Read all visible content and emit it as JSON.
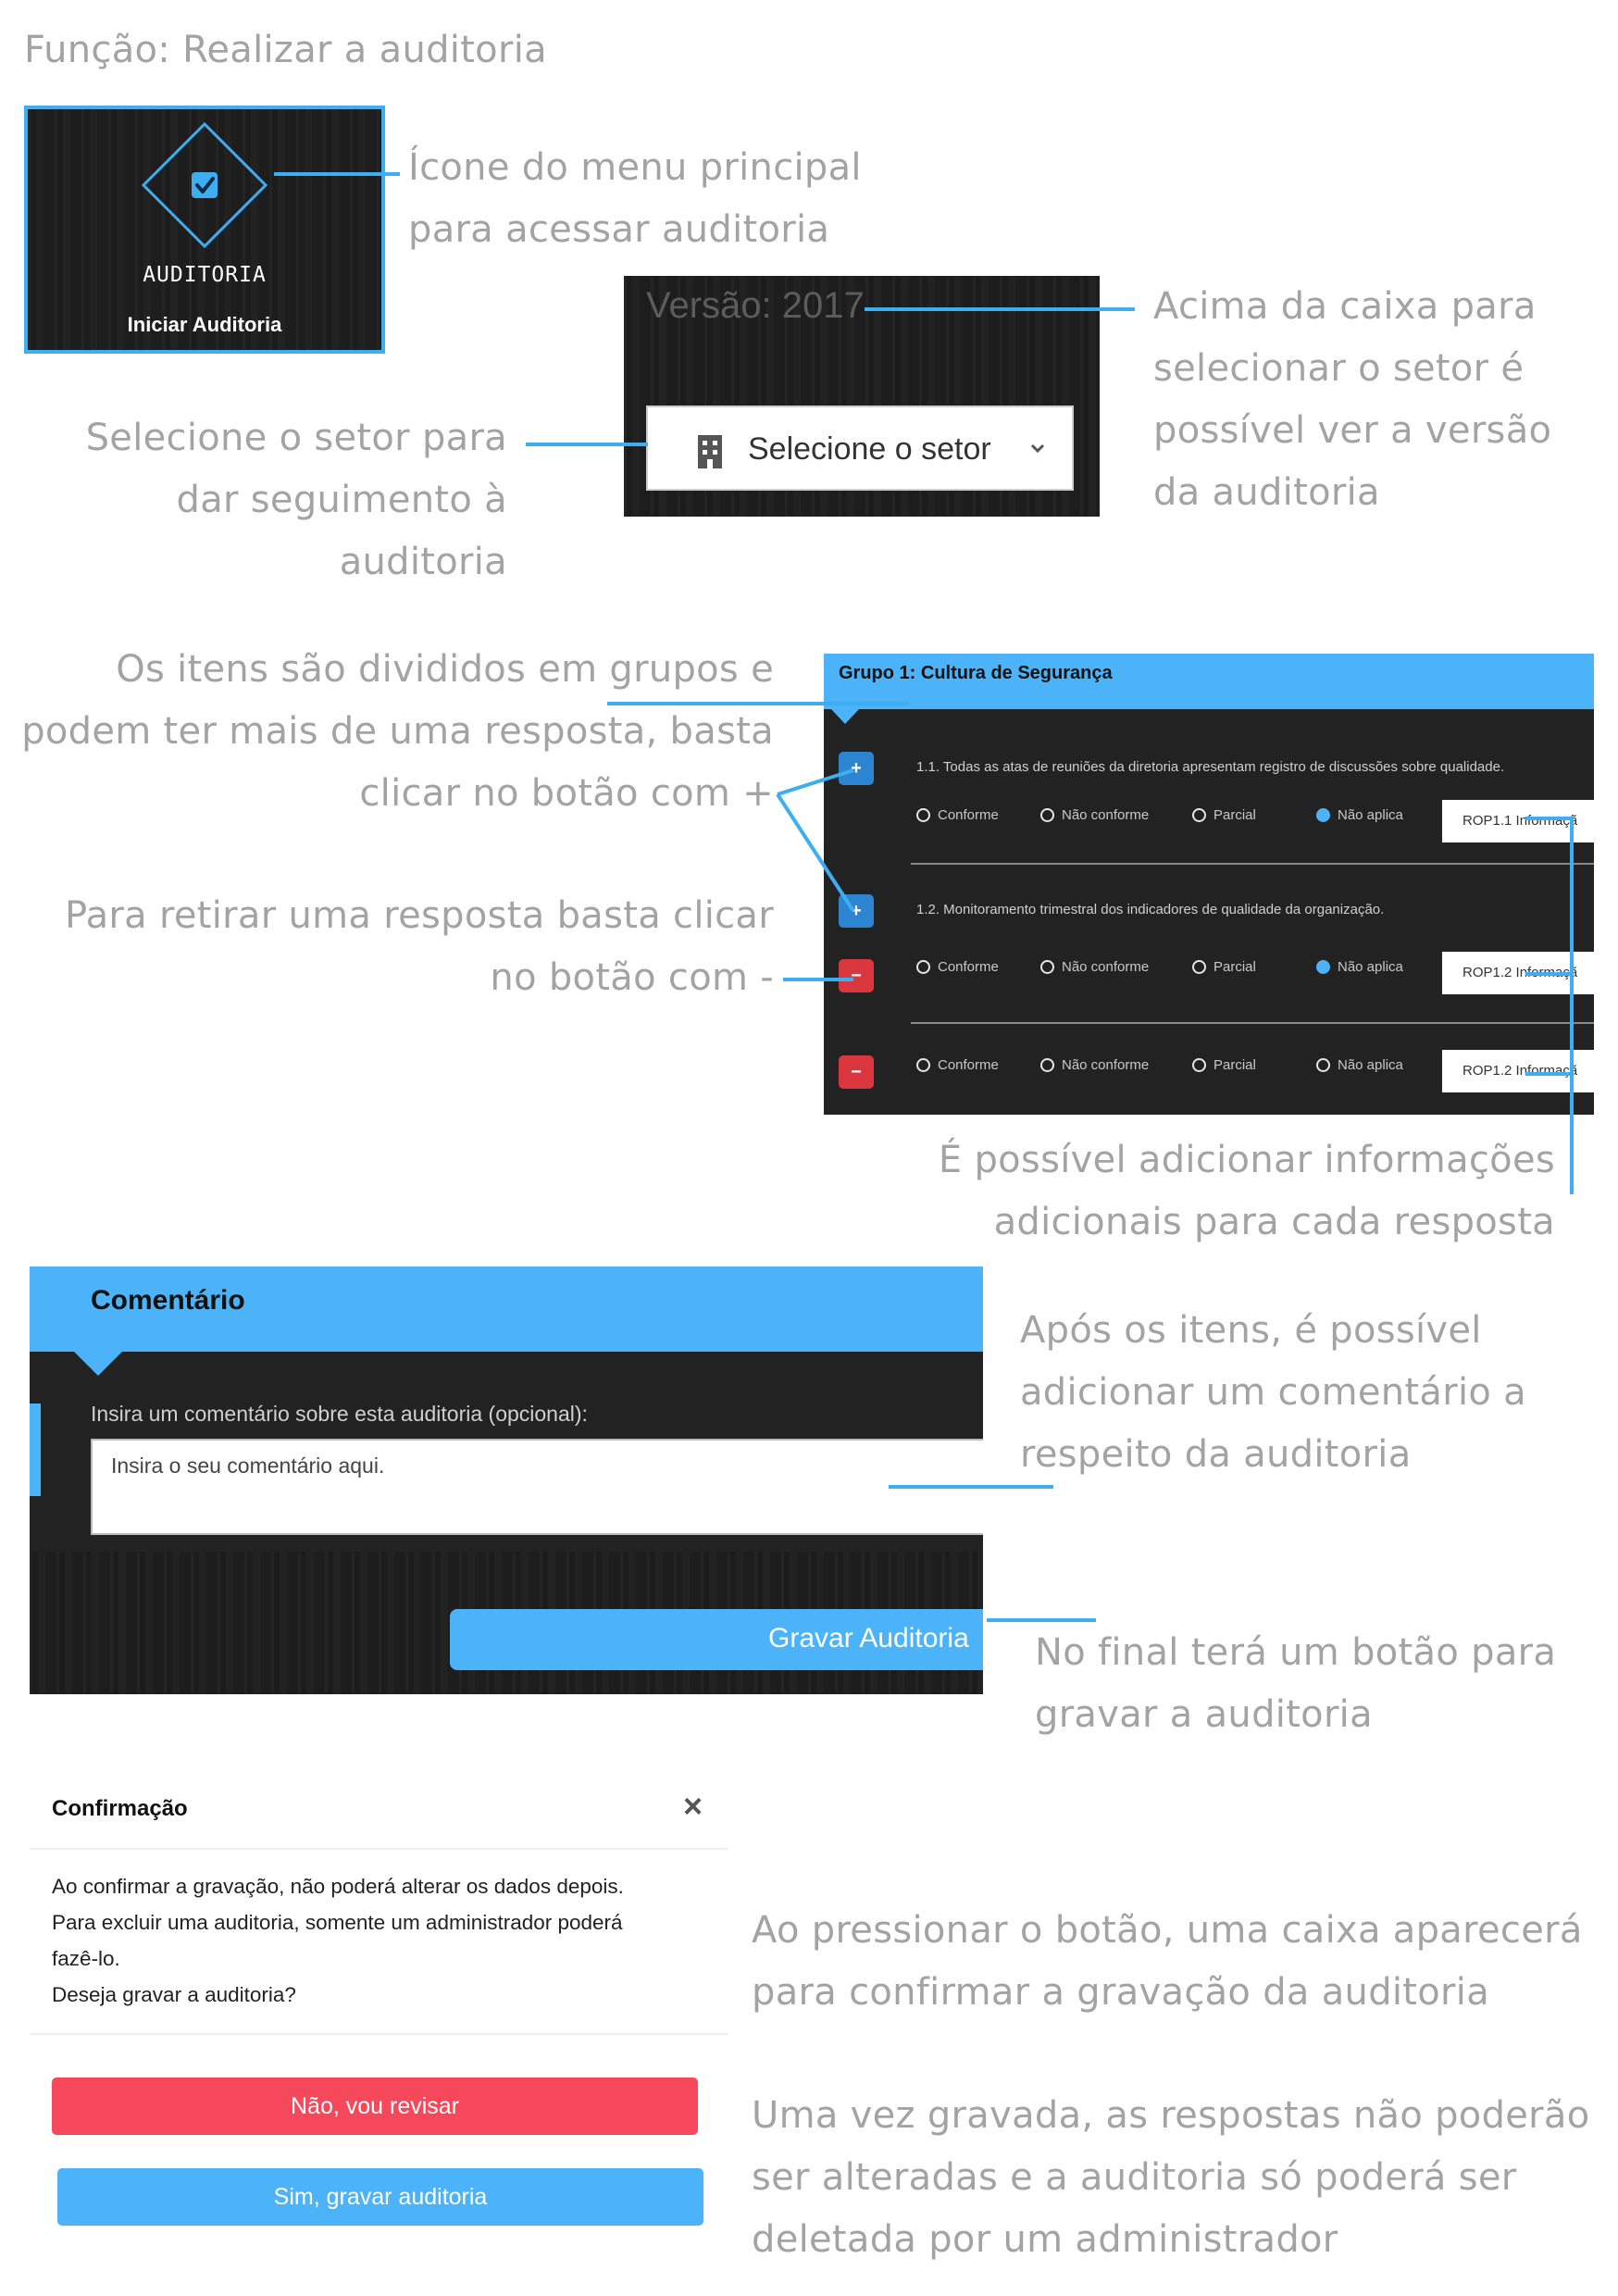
{
  "page_title": "Função: Realizar a auditoria",
  "menu_tile": {
    "title": "AUDITORIA",
    "subtitle": "Iniciar Auditoria",
    "icon": "checkbox-diamond-icon"
  },
  "annotations": {
    "menu_icon": [
      "Ícone do menu principal",
      "para acessar auditoria"
    ],
    "version": [
      "Acima da caixa para",
      "selecionar o setor é",
      "possível ver a versão",
      "da auditoria"
    ],
    "sector": [
      "Selecione o setor para",
      "dar seguimento à",
      "auditoria"
    ],
    "groups": [
      "Os itens são divididos em grupos e",
      "podem ter mais de uma resposta, basta",
      "clicar no botão com +"
    ],
    "remove": [
      "Para retirar uma resposta basta clicar",
      "no botão com -"
    ],
    "info": [
      "É possível adicionar informações",
      "adicionais para cada resposta"
    ],
    "comment": [
      "Após os itens, é possível",
      "adicionar um comentário a",
      "respeito da auditoria"
    ],
    "save_button": [
      "No final terá um botão para",
      "gravar a auditoria"
    ],
    "confirm_box": [
      "Ao pressionar o botão, uma caixa aparecerá",
      "para confirmar a gravação da auditoria"
    ],
    "saved": [
      "Uma vez gravada, as respostas não poderão",
      "ser alteradas e a auditoria só poderá ser",
      "deletada por um administrador"
    ]
  },
  "version_panel": {
    "version_label": "Versão: 2017",
    "sector_select": "Selecione o setor"
  },
  "group": {
    "title": "Grupo 1: Cultura de Segurança",
    "options": [
      "Conforme",
      "Não conforme",
      "Parcial",
      "Não aplica"
    ],
    "items": [
      {
        "question": "1.1. Todas as atas de reuniões da diretoria apresentam registro de discussões sobre qualidade.",
        "selected": "Não aplica",
        "info": "ROP1.1 Informaçã"
      },
      {
        "question": "1.2. Monitoramento trimestral dos indicadores de qualidade da organização.",
        "selected": "Não aplica",
        "info": "ROP1.2 Informaçã"
      },
      {
        "question": "",
        "selected": "",
        "info": "ROP1.2 Informaçã"
      }
    ]
  },
  "comment_panel": {
    "title": "Comentário",
    "label": "Insira um comentário sobre esta auditoria (opcional):",
    "placeholder": "Insira o seu comentário aqui.",
    "save_button": "Gravar Auditoria"
  },
  "confirm_dialog": {
    "title": "Confirmação",
    "close": "×",
    "body": [
      "Ao confirmar a gravação, não poderá alterar os dados depois.",
      "Para excluir uma auditoria, somente um administrador poderá",
      "fazê-lo.",
      "Deseja gravar a auditoria?"
    ],
    "no_button": "Não, vou revisar",
    "yes_button": "Sim, gravar auditoria"
  },
  "colors": {
    "accent": "#4db3f8",
    "annotation_line": "#3daef1",
    "annotation_text": "#a3a3a3",
    "plus_button": "#2d84d1",
    "minus_button": "#d9373d",
    "no_button": "#f6485b",
    "dark_panel": "#1e1e1e"
  }
}
